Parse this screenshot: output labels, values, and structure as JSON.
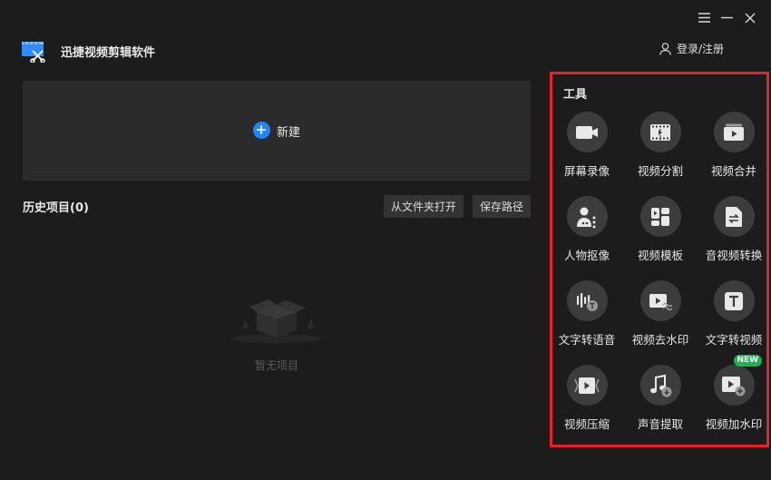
{
  "window": {
    "controls": [
      "menu-icon",
      "minimize-icon",
      "close-icon"
    ]
  },
  "header": {
    "app_title": "迅捷视频剪辑软件",
    "login_label": "登录/注册"
  },
  "main": {
    "new_label": "新建",
    "history_title": "历史项目(0)",
    "open_folder_label": "从文件夹打开",
    "save_path_label": "保存路径",
    "empty_text": "暂无项目"
  },
  "tools": {
    "title": "工具",
    "items": [
      {
        "label": "屏幕录像",
        "icon": "camera-icon"
      },
      {
        "label": "视频分割",
        "icon": "film-split-icon"
      },
      {
        "label": "视频合并",
        "icon": "video-merge-icon"
      },
      {
        "label": "人物抠像",
        "icon": "portrait-icon"
      },
      {
        "label": "视频模板",
        "icon": "template-icon"
      },
      {
        "label": "音视频转换",
        "icon": "convert-icon"
      },
      {
        "label": "文字转语音",
        "icon": "text-to-speech-icon"
      },
      {
        "label": "视频去水印",
        "icon": "remove-watermark-icon"
      },
      {
        "label": "文字转视频",
        "icon": "text-to-video-icon"
      },
      {
        "label": "视频压缩",
        "icon": "compress-icon"
      },
      {
        "label": "声音提取",
        "icon": "music-extract-icon"
      },
      {
        "label": "视频加水印",
        "icon": "add-watermark-icon",
        "badge": "NEW"
      }
    ]
  },
  "colors": {
    "accent_blue": "#1f86ff",
    "highlight_red": "#e8212a",
    "new_badge_green": "#18b34f"
  }
}
